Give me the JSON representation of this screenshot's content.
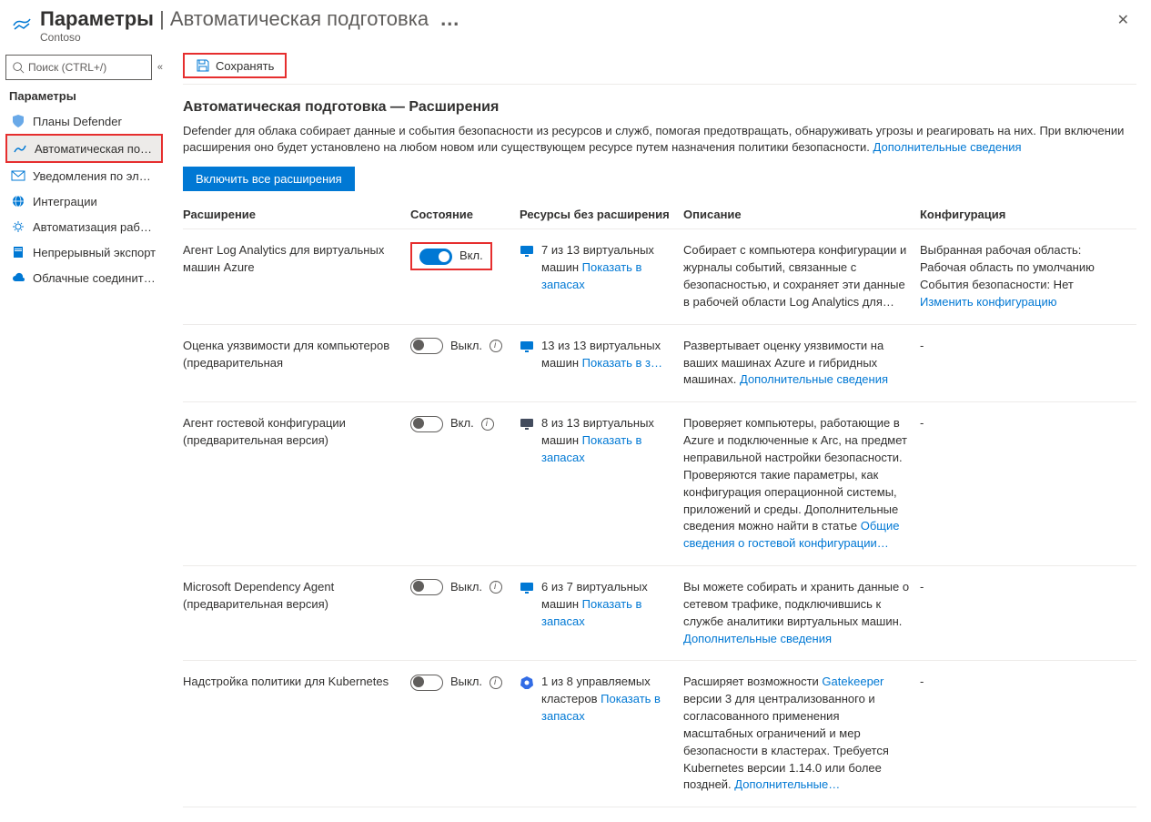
{
  "header": {
    "title_main": "Параметры",
    "title_sub": "Автоматическая подготовка",
    "dots": "…",
    "org": "Contoso"
  },
  "sidebar": {
    "search_placeholder": "Поиск (CTRL+/)",
    "heading": "Параметры",
    "items": [
      {
        "label": "Планы Defender",
        "icon": "shield"
      },
      {
        "label": "Автоматическая по…",
        "icon": "provision",
        "active": true,
        "highlight": true
      },
      {
        "label": "Уведомления по эл…",
        "icon": "mail"
      },
      {
        "label": "Интеграции",
        "icon": "globe"
      },
      {
        "label": "Автоматизация рабо…",
        "icon": "gear"
      },
      {
        "label": "Непрерывный экспорт",
        "icon": "book"
      },
      {
        "label": "Облачные соединит…",
        "icon": "cloud"
      }
    ]
  },
  "toolbar": {
    "save": "Сохранять"
  },
  "main": {
    "section_title": "Автоматическая подготовка — Расширения",
    "desc_part1": "Defender для облака собирает данные и события безопасности из ресурсов и служб, помогая предотвращать, обнаруживать угрозы и реагировать на них. При включении расширения оно будет установлено на любом новом или существующем ресурсе путем назначения политики безопасности. ",
    "desc_link": "Дополнительные сведения",
    "enable_all": "Включить все расширения"
  },
  "columns": {
    "ext": "Расширение",
    "state": "Состояние",
    "res": "Ресурсы без расширения",
    "desc": "Описание",
    "conf": "Конфигурация"
  },
  "rows": [
    {
      "name": "Агент Log Analytics для виртуальных машин Azure",
      "state_on": true,
      "state_label": "Вкл.",
      "state_highlight": true,
      "res_text": "7 из 13 виртуальных машин ",
      "res_link": "Показать в запасах",
      "res_icon": "vm-blue",
      "desc_text": "Собирает с компьютера конфигурации и журналы событий, связанные с безопасностью, и сохраняет эти данные в рабочей области Log Analytics для…",
      "desc_link": "",
      "conf_text": "Выбранная рабочая область: Рабочая область по умолчанию События безопасности: Нет",
      "conf_link": "Изменить конфигурацию"
    },
    {
      "name": "Оценка уязвимости для компьютеров (предварительная",
      "state_on": false,
      "state_label": "Выкл.",
      "has_info": true,
      "res_text": "13 из 13 виртуальных машин ",
      "res_link": "Показать в з…",
      "res_icon": "vm-blue",
      "desc_text": "Развертывает оценку уязвимости на ваших машинах Azure и гибридных машинах. ",
      "desc_link": "Дополнительные сведения",
      "conf_text": "-"
    },
    {
      "name": "Агент гостевой конфигурации (предварительная версия)",
      "state_on": false,
      "state_label": "Вкл.",
      "has_info": true,
      "res_text": "8 из 13 виртуальных машин ",
      "res_link": "Показать в запасах",
      "res_icon": "vm-dark",
      "desc_text": "Проверяет компьютеры, работающие в Azure и подключенные к Arc, на предмет неправильной настройки безопасности. Проверяются такие параметры, как конфигурация операционной системы, приложений и среды. Дополнительные сведения можно найти в статье ",
      "desc_link": "Общие сведения о гостевой конфигурации…",
      "conf_text": "-"
    },
    {
      "name": "Microsoft Dependency Agent (предварительная версия)",
      "state_on": false,
      "state_label": "Выкл.",
      "has_info": true,
      "res_text": "6 из 7 виртуальных машин ",
      "res_link": "Показать в запасах",
      "res_icon": "vm-blue",
      "desc_text": "Вы можете собирать и хранить данные о сетевом трафике, подключившись к службе аналитики виртуальных машин. ",
      "desc_link": "Дополнительные сведения",
      "conf_text": "-"
    },
    {
      "name": "Надстройка политики для Kubernetes",
      "state_on": false,
      "state_label": "Выкл.",
      "has_info": true,
      "res_text": "1 из 8 управляемых кластеров ",
      "res_link": "Показать в запасах",
      "res_icon": "k8s",
      "desc_text1": "Расширяет возможности ",
      "desc_link1": "Gatekeeper",
      "desc_text2": " версии 3 для централизованного и согласованного применения масштабных ограничений и мер безопасности в кластерах. Требуется Kubernetes версии 1.14.0 или более поздней. ",
      "desc_link2": "Дополнительные…",
      "conf_text": "-"
    }
  ]
}
